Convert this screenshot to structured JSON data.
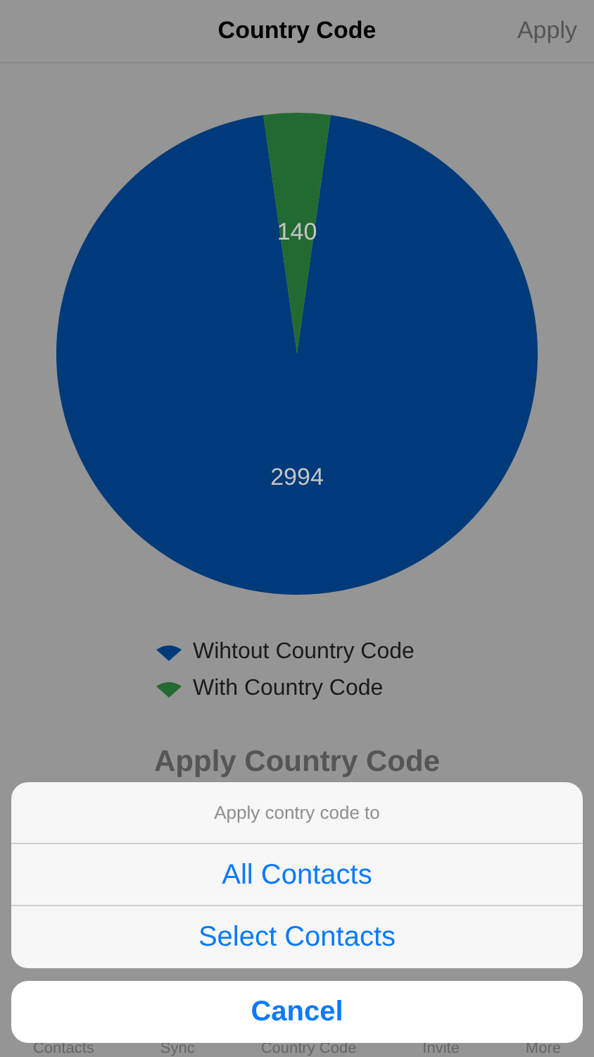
{
  "nav": {
    "title": "Country Code",
    "action": "Apply"
  },
  "chart_data": {
    "type": "pie",
    "categories": [
      "Wihtout Country Code",
      "With Country Code"
    ],
    "series": [
      {
        "values": [
          2994,
          140
        ]
      }
    ],
    "data_labels": true
  },
  "legend": [
    {
      "color": "#003a7a"
    },
    {
      "color": "#236a32"
    }
  ],
  "section_title": "Apply Country Code",
  "action_sheet": {
    "title": "Apply contry code to",
    "options": [
      "All Contacts",
      "Select Contacts"
    ],
    "cancel": "Cancel"
  },
  "tab_bar": [
    "Contacts",
    "Sync",
    "Country Code",
    "Invite",
    "More"
  ]
}
